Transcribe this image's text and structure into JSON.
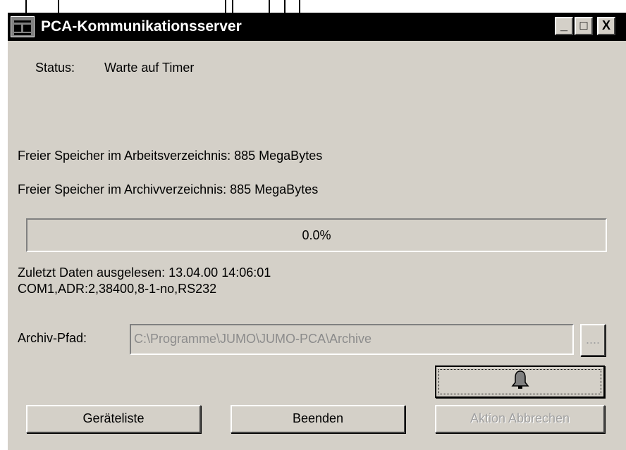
{
  "window": {
    "title": "PCA-Kommunikationsserver",
    "minimize_label": "_",
    "maximize_label": "□",
    "close_label": "X"
  },
  "status": {
    "label": "Status:",
    "value": "Warte auf Timer"
  },
  "memory": {
    "work_label": "Freier Speicher im Arbeitsverzeichnis:",
    "work_value": "885 MegaBytes",
    "archive_label": "Freier Speicher im Archivverzeichnis:",
    "archive_value": "885 MegaBytes"
  },
  "progress": {
    "text": "0.0%",
    "percent": 0
  },
  "last_read": {
    "line1": "Zuletzt Daten ausgelesen: 13.04.00 14:06:01",
    "line2": "COM1,ADR:2,38400,8-1-no,RS232"
  },
  "archive_path": {
    "label": "Archiv-Pfad:",
    "value": "C:\\Programme\\JUMO\\JUMO-PCA\\Archive",
    "browse_label": "...."
  },
  "buttons": {
    "devices": "Geräteliste",
    "quit": "Beenden",
    "cancel": "Aktion Abbrechen"
  },
  "icons": {
    "app": "computer-icon",
    "bell": "bell-icon"
  }
}
